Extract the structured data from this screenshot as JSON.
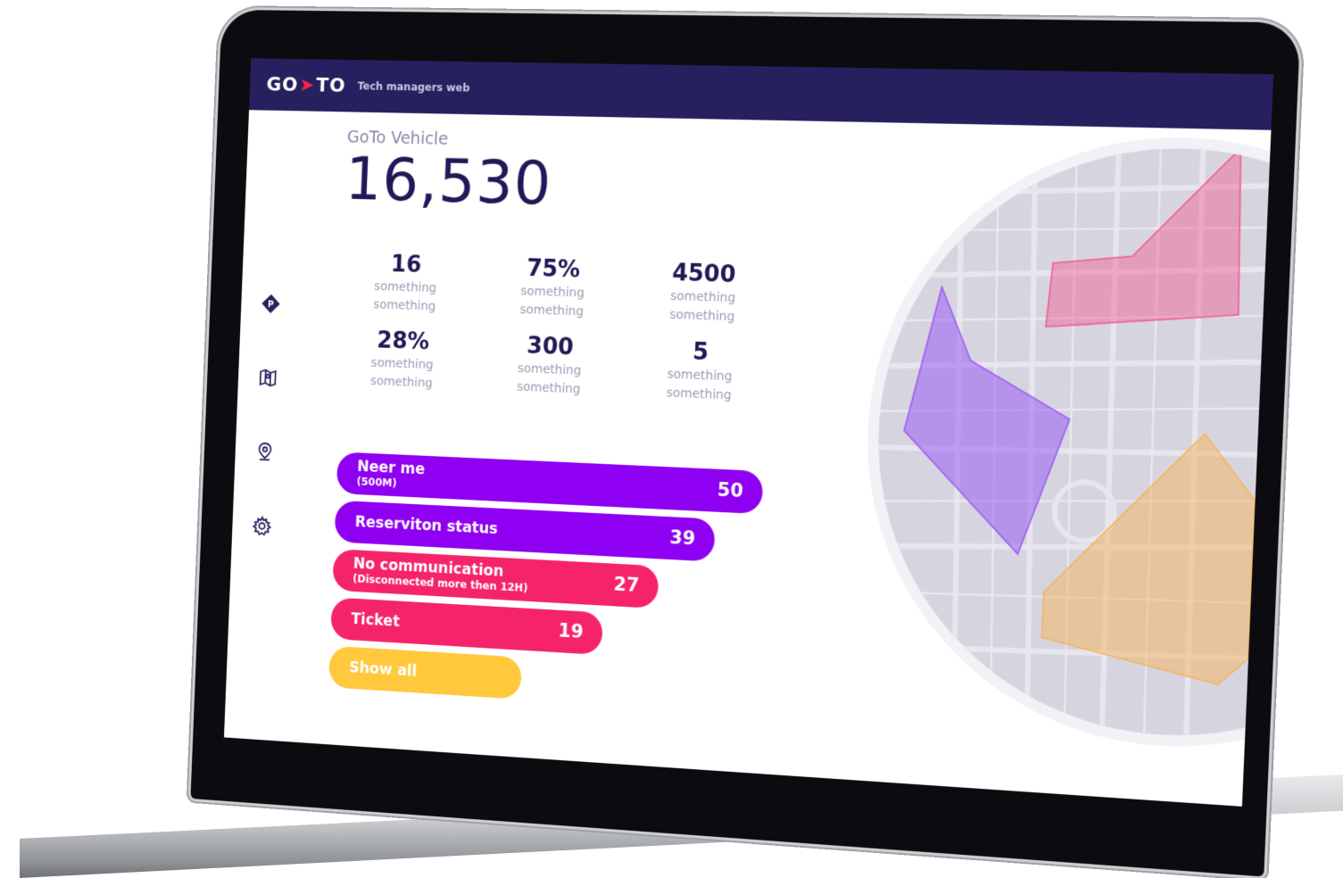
{
  "header": {
    "logo_left": "GO",
    "logo_right": "TO",
    "subtitle": "Tech managers web"
  },
  "sidenav": {
    "items": [
      {
        "icon": "parking-icon"
      },
      {
        "icon": "map-icon"
      },
      {
        "icon": "location-pin-icon"
      },
      {
        "icon": "gear-icon"
      }
    ]
  },
  "kpi": {
    "label": "GoTo Vehicle",
    "value": "16,530"
  },
  "stats": [
    {
      "value": "16",
      "caption": "something something"
    },
    {
      "value": "75%",
      "caption": "something something"
    },
    {
      "value": "4500",
      "caption": "something something"
    },
    {
      "value": "28%",
      "caption": "something something"
    },
    {
      "value": "300",
      "caption": "something something"
    },
    {
      "value": "5",
      "caption": "something something"
    }
  ],
  "bars": [
    {
      "title": "Neer me",
      "note": "(500M)",
      "count": "50",
      "color": "#8f00f2"
    },
    {
      "title": "Reserviton status",
      "note": "",
      "count": "39",
      "color": "#8f00f2"
    },
    {
      "title": "No communication",
      "note": "(Disconnected more then 12H)",
      "count": "27",
      "color": "#f5246a"
    },
    {
      "title": "Ticket",
      "note": "",
      "count": "19",
      "color": "#f5246a"
    }
  ],
  "show_all": {
    "label": "Show all",
    "color": "#ffc83d"
  },
  "map": {
    "zones": [
      {
        "name": "pink-zone",
        "color": "#f25c8f"
      },
      {
        "name": "purple-zone",
        "color": "#9b5cf2"
      },
      {
        "name": "orange-zone",
        "color": "#f5b35c"
      }
    ]
  }
}
